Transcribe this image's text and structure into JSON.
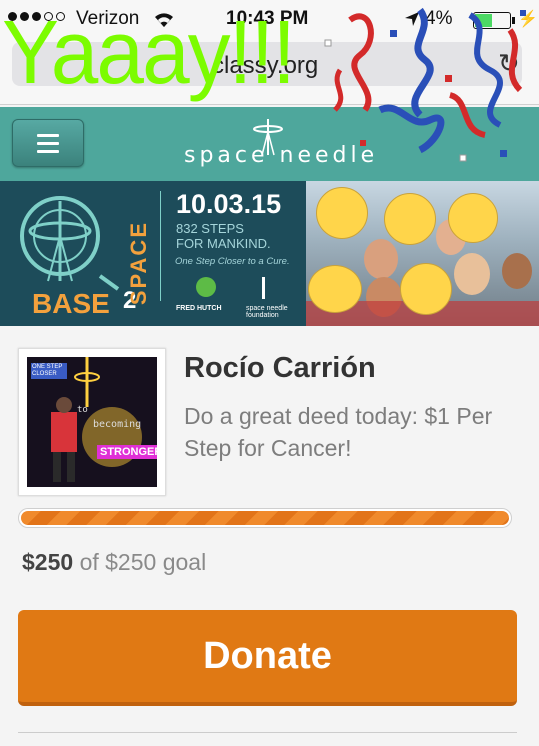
{
  "status_bar": {
    "carrier": "Verizon",
    "time": "10:43 PM",
    "battery_percent": "4%",
    "battery_level": 0.5
  },
  "browser": {
    "url": "classy.org"
  },
  "overlay": {
    "caption": "Yaaay!!!"
  },
  "header": {
    "brand": "space needle"
  },
  "banner": {
    "date": "10.03.15",
    "steps_line1": "832 STEPS",
    "steps_line2": "FOR MANKIND.",
    "tagline": "One Step Closer to a Cure.",
    "base_text": "BASE",
    "two_text": "2",
    "space_text": "SPACE",
    "sponsor1": "FRED HUTCH",
    "sponsor2": "space needle foundation"
  },
  "fundraiser": {
    "name": "Rocío Carrión",
    "description": "Do a great deed today: $1 Per Step for Cancer!",
    "photo_text": {
      "line1": "ONE STEP CLOSER",
      "line2": "to",
      "line3": "becoming",
      "line4": "STRONGER!"
    },
    "raised": "$250",
    "goal_text": "of $250 goal",
    "progress_fraction": 1.0,
    "donate_label": "Donate"
  },
  "colors": {
    "header_teal": "#4ea79c",
    "accent_orange": "#e07914",
    "overlay_green": "#7cfc00"
  }
}
